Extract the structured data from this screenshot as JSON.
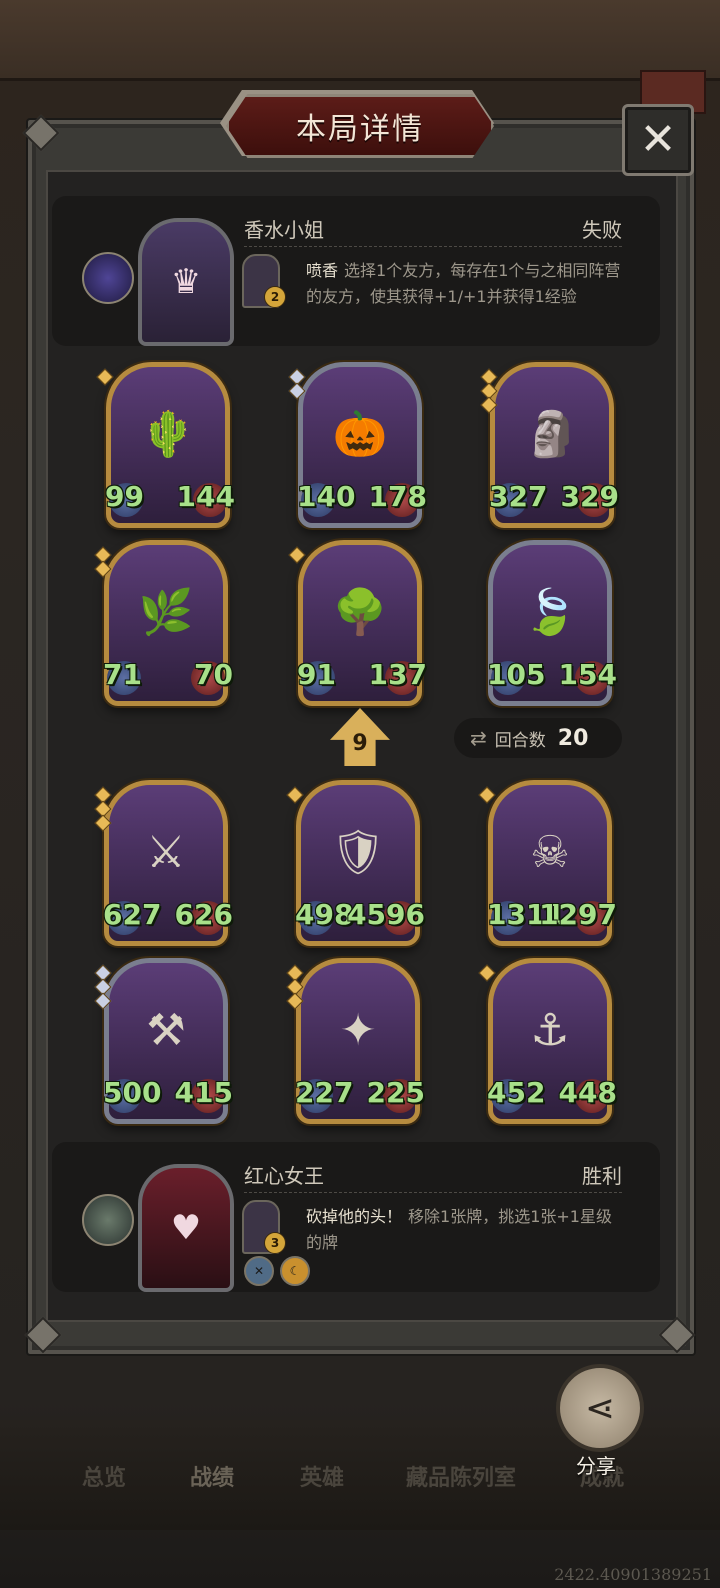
{
  "title": "本局详情",
  "close_icon": "close-icon",
  "opponent": {
    "name": "香水小姐",
    "result": "失败",
    "hero_level": "2",
    "skill_name": "喷香",
    "skill_desc": "选择1个友方，每存在1个与之相同阵营的友方，使其获得+1/+1并获得1经验"
  },
  "player": {
    "name": "红心女王",
    "result": "胜利",
    "hero_level": "3",
    "skill_name": "砍掉他的头！",
    "skill_desc": "移除1张牌，挑选1张+1星级的牌"
  },
  "opponent_board": [
    {
      "atk": "99",
      "hp": "144",
      "icon": "cactus-icon",
      "stars": 1
    },
    {
      "atk": "140",
      "hp": "178",
      "icon": "pumpkin-icon",
      "stars": 2
    },
    {
      "atk": "327",
      "hp": "329",
      "icon": "totem-icon",
      "stars": 3
    },
    {
      "atk": "71",
      "hp": "70",
      "icon": "shadow-plant-icon",
      "stars": 2
    },
    {
      "atk": "91",
      "hp": "137",
      "icon": "treant-icon",
      "stars": 1
    },
    {
      "atk": "105",
      "hp": "154",
      "icon": "dryad-icon",
      "stars": 0
    }
  ],
  "player_board": [
    {
      "atk": "627",
      "hp": "626",
      "icon": "warrior-icon",
      "stars": 3
    },
    {
      "atk": "498",
      "hp": "4596",
      "icon": "knight-icon",
      "stars": 1
    },
    {
      "atk": "1311",
      "hp": "1297",
      "icon": "pirate-icon",
      "stars": 1
    },
    {
      "atk": "500",
      "hp": "415",
      "icon": "dwarf-icon",
      "stars": 3
    },
    {
      "atk": "227",
      "hp": "225",
      "icon": "valkyrie-icon",
      "stars": 3
    },
    {
      "atk": "452",
      "hp": "448",
      "icon": "pirate-queen-icon",
      "stars": 1
    }
  ],
  "tier_level": "9",
  "rounds": {
    "label": "回合数",
    "value": "20"
  },
  "nav": {
    "overview": "总览",
    "record": "战绩",
    "heroes": "英雄",
    "collection": "藏品陈列室",
    "achievements": "成就"
  },
  "share_label": "分享",
  "version": "2422.40901389251"
}
